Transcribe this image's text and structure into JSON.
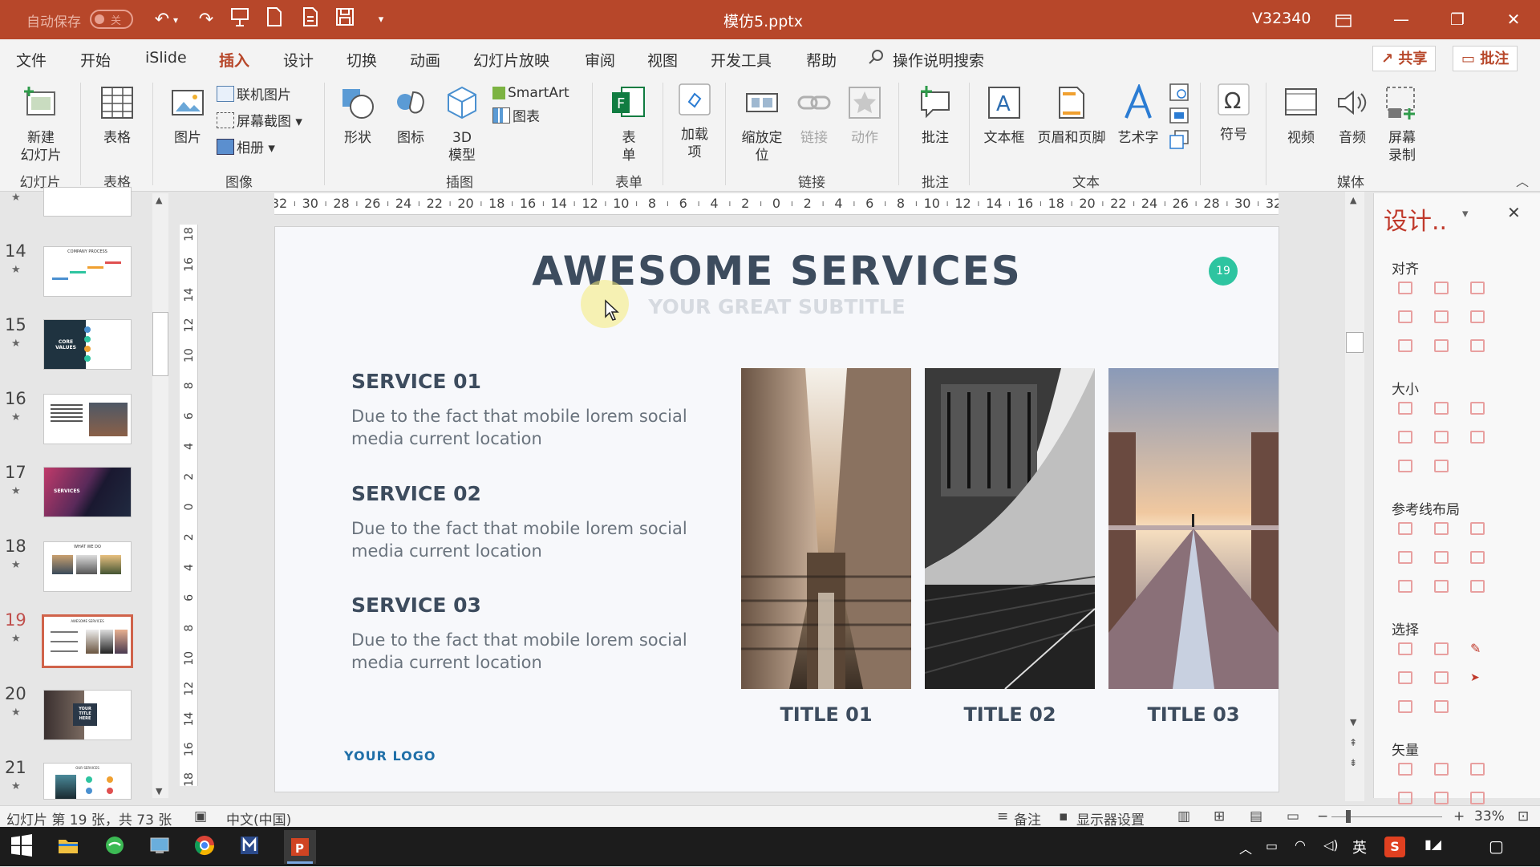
{
  "titlebar": {
    "autosave_label": "自动保存",
    "autosave_state": "关",
    "filename": "模仿5.pptx",
    "user": "V32340"
  },
  "menu": {
    "tabs": [
      "文件",
      "开始",
      "iSlide",
      "插入",
      "设计",
      "切换",
      "动画",
      "幻灯片放映",
      "审阅",
      "视图",
      "开发工具",
      "帮助"
    ],
    "active_tab": "插入",
    "search_placeholder": "操作说明搜索",
    "share_label": "共享",
    "comment_label": "批注"
  },
  "ribbon": {
    "new_slide": "新建\n幻灯片",
    "table": "表格",
    "picture": "图片",
    "online_picture": "联机图片",
    "screenshot": "屏幕截图",
    "album": "相册",
    "shapes": "形状",
    "icons": "图标",
    "model3d": "3D\n模型",
    "smartart": "SmartArt",
    "chart": "图表",
    "forms": "表\n单",
    "addins": "加载\n项",
    "zoom": "缩放定\n位",
    "link": "链接",
    "action": "动作",
    "comment": "批注",
    "textbox": "文本框",
    "header_footer": "页眉和页脚",
    "wordart": "艺术字",
    "symbol": "符号",
    "video": "视频",
    "audio": "音频",
    "screen_record": "屏幕\n录制",
    "groups": {
      "slides": "幻灯片",
      "tables": "表格",
      "images": "图像",
      "illustrations": "插图",
      "forms": "表单",
      "links": "链接",
      "comments": "批注",
      "text": "文本",
      "media": "媒体"
    }
  },
  "thumbnails": [
    {
      "num": "14",
      "mark": "★",
      "caption": "COMPANY PROCESS"
    },
    {
      "num": "15",
      "mark": "★",
      "caption": "CORE VALUES"
    },
    {
      "num": "16",
      "mark": "★",
      "caption": ""
    },
    {
      "num": "17",
      "mark": "★",
      "caption": "SERVICES"
    },
    {
      "num": "18",
      "mark": "★",
      "caption": "WHAT WE DO"
    },
    {
      "num": "19",
      "mark": "★",
      "caption": "AWESOME SERVICES"
    },
    {
      "num": "20",
      "mark": "★",
      "caption": "YOUR TITLE HERE"
    },
    {
      "num": "21",
      "mark": "★",
      "caption": "OUR SERVICES"
    }
  ],
  "ruler": {
    "horizontal": [
      "32",
      "30",
      "28",
      "26",
      "24",
      "22",
      "20",
      "18",
      "16",
      "14",
      "12",
      "10",
      "8",
      "6",
      "4",
      "2",
      "0",
      "2",
      "4",
      "6",
      "8",
      "10",
      "12",
      "14",
      "16",
      "18",
      "20",
      "22",
      "24",
      "26",
      "28",
      "30",
      "32"
    ],
    "vertical": [
      "18",
      "16",
      "14",
      "12",
      "10",
      "8",
      "6",
      "4",
      "2",
      "0",
      "2",
      "4",
      "6",
      "8",
      "10",
      "12",
      "14",
      "16",
      "18"
    ]
  },
  "slide": {
    "title": "AWESOME SERVICES",
    "subtitle": "YOUR GREAT SUBTITLE",
    "page_badge": "19",
    "services": [
      {
        "title": "SERVICE 01",
        "body": "Due to the fact that mobile lorem social media current location"
      },
      {
        "title": "SERVICE 02",
        "body": "Due to the fact that mobile lorem social media current location"
      },
      {
        "title": "SERVICE 03",
        "body": "Due to the fact that mobile lorem social media current location"
      }
    ],
    "photo_titles": [
      "TITLE 01",
      "TITLE 02",
      "TITLE 03"
    ],
    "logo": "YOUR LOGO"
  },
  "design_pane": {
    "title": "设计..",
    "sections": [
      "对齐",
      "大小",
      "参考线布局",
      "选择",
      "矢量"
    ]
  },
  "status": {
    "slide_info": "幻灯片 第 19 张，共 73 张",
    "language": "中文(中国)",
    "notes": "备注",
    "display_settings": "显示器设置",
    "zoom": "33%"
  },
  "taskbar": {
    "ime": "英"
  },
  "colors": {
    "accent": "#b7472a",
    "slide_title": "#3d4c5e",
    "badge": "#2ec4a0",
    "logo": "#1f6fa8",
    "design_icon": "#e8a0a0"
  }
}
